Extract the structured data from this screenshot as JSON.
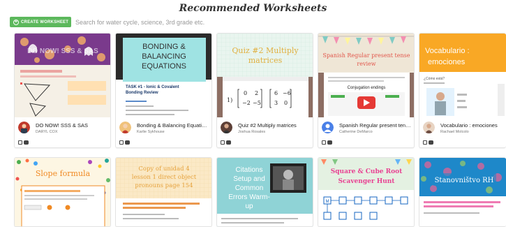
{
  "header": {
    "title": "Recommended Worksheets",
    "create_label": "CREATE WORKSHEET",
    "search_placeholder": "Search for water cycle, science, 3rd grade etc."
  },
  "cards": [
    {
      "title": "DO NOW! SSS & SAS",
      "author": "DARYL COX",
      "thumb_text": "DO NOW! SSS & SAS",
      "colors": {
        "bg": "#7a3a8c",
        "accent": "#f7b267"
      }
    },
    {
      "title": "Bonding & Balancing Equations",
      "author": "Karlie Sykhouse",
      "thumb_text": "BONDING & BALANCING EQUATIONS",
      "thumb_sub": "TASK #1 - Ionic & Covalent Bonding Review",
      "colors": {
        "bg": "#9fe3e3",
        "accent": "#2a2a2a"
      }
    },
    {
      "title": "Quiz #2 Multiply matrices",
      "author": "Joshua Rosales",
      "thumb_text": "Quiz #2 Multiply matrices",
      "colors": {
        "bg": "#e9f5ef",
        "accent": "#e0b040"
      }
    },
    {
      "title": "Spanish Regular present tense ...",
      "author": "Catherine DeMarco",
      "thumb_text": "Spanish Regular present tense review",
      "thumb_sub": "Conjugation endings",
      "colors": {
        "bg": "#f3ece0",
        "accent": "#e2574c"
      }
    },
    {
      "title": "Vocabulario : emociones",
      "author": "Rachael Molcolo",
      "thumb_text": "Vocabulario : emociones",
      "thumb_sub": "¿Cómo está?",
      "colors": {
        "bg": "#f9a825",
        "accent": "#ffffff"
      }
    },
    {
      "title": "",
      "author": "",
      "thumb_text": "Slope formula",
      "colors": {
        "bg": "#fdf6e3",
        "accent": "#f08a24"
      }
    },
    {
      "title": "",
      "author": "",
      "thumb_text": "Copy of unidad 4 lesson 1 direct object pronouns page 154",
      "colors": {
        "bg": "#fbe9c6",
        "accent": "#e67e22"
      }
    },
    {
      "title": "",
      "author": "",
      "thumb_text": "Citations Setup and Common Errors Warm-up",
      "colors": {
        "bg": "#8fd3d6",
        "accent": "#ffffff"
      }
    },
    {
      "title": "",
      "author": "",
      "thumb_text": "Square & Cube Root Scavenger Hunt",
      "colors": {
        "bg": "#e4f1e2",
        "accent": "#e84393"
      }
    },
    {
      "title": "",
      "author": "",
      "thumb_text": "Stanovništvo RH",
      "colors": {
        "bg": "#1e88c9",
        "accent": "#ffffff"
      }
    }
  ]
}
